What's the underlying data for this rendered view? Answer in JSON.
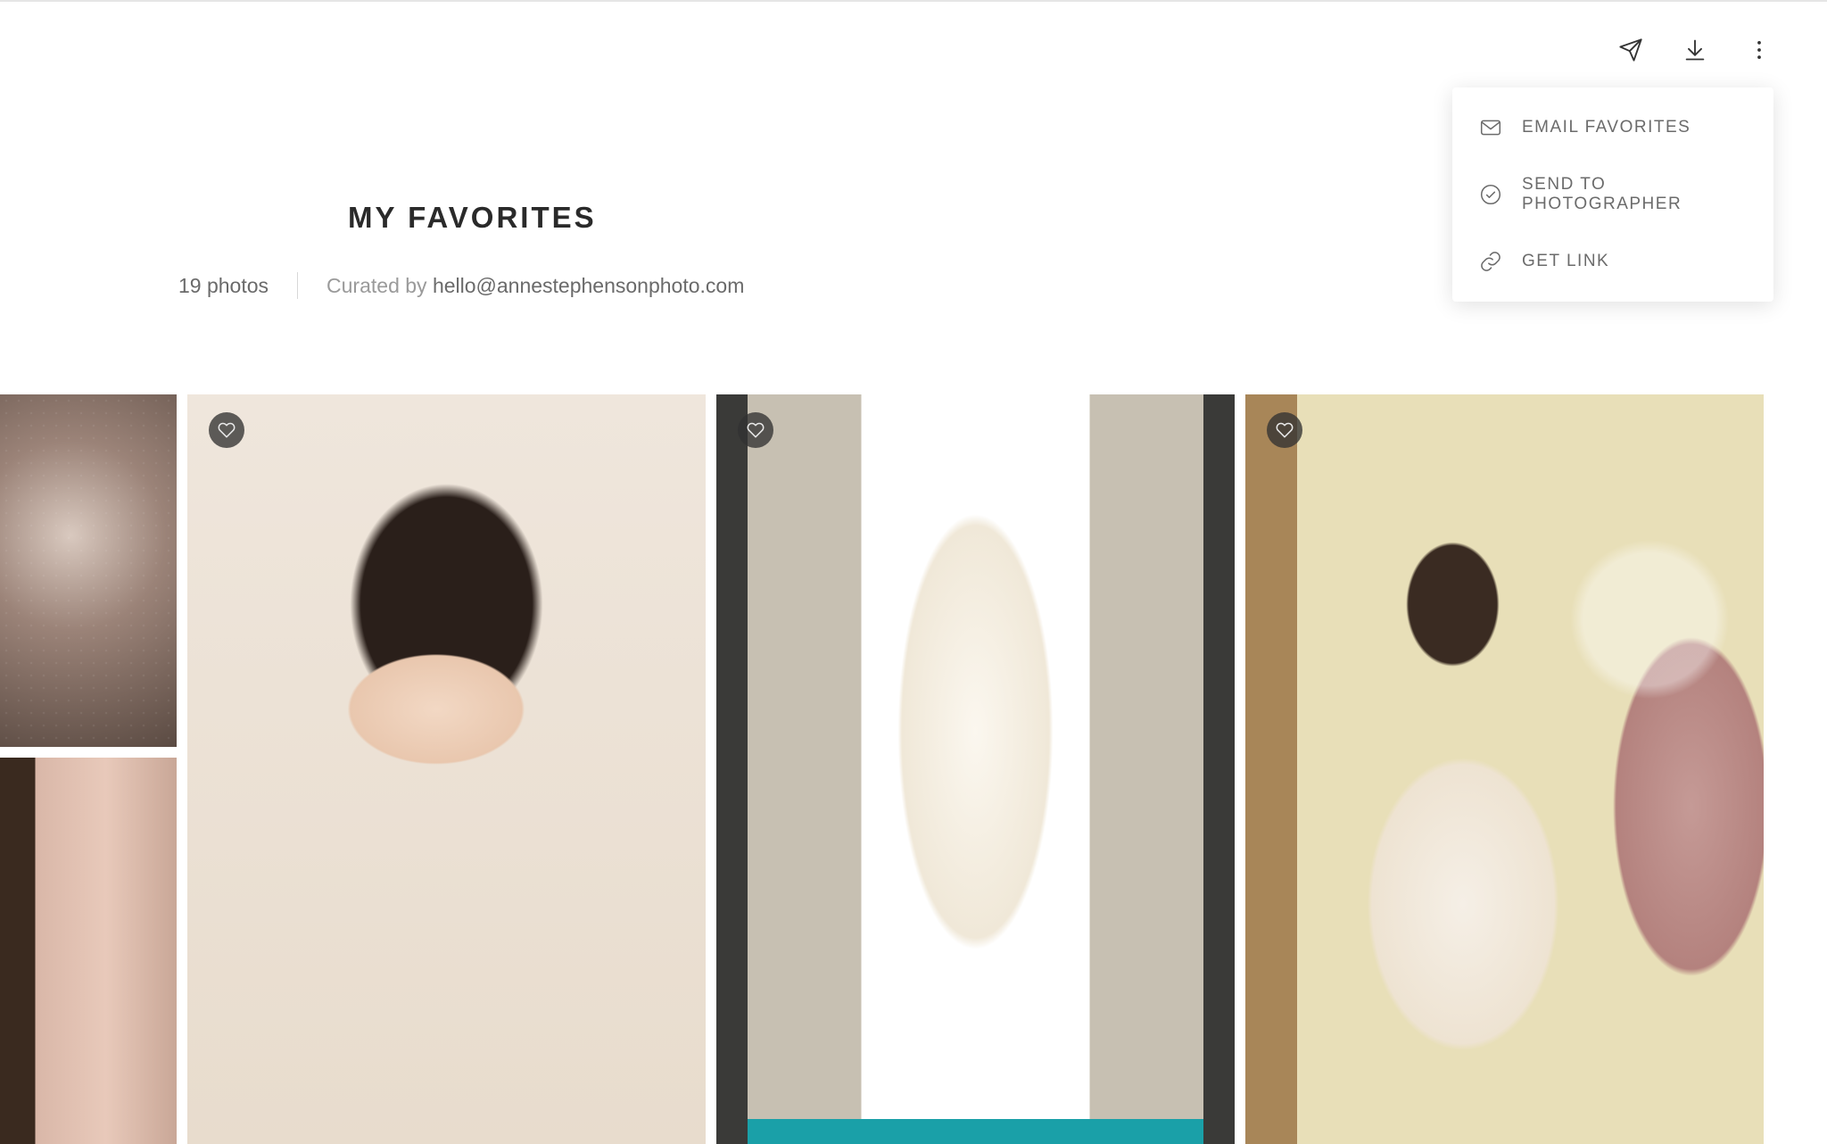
{
  "header": {
    "title": "MY FAVORITES",
    "photo_count": "19 photos",
    "curated_label": "Curated by ",
    "curated_by": "hello@annestephensonphoto.com"
  },
  "toolbar": {
    "share_icon": "paper-plane",
    "download_icon": "download",
    "more_icon": "more-vertical"
  },
  "dropdown": {
    "items": [
      {
        "icon": "envelope",
        "label": "EMAIL FAVORITES"
      },
      {
        "icon": "check-circle",
        "label": "SEND TO PHOTOGRAPHER"
      },
      {
        "icon": "link",
        "label": "GET LINK"
      }
    ]
  },
  "gallery": {
    "items": [
      {
        "alt": "sparkle-detail",
        "favorited": false
      },
      {
        "alt": "doorway-detail",
        "favorited": false
      },
      {
        "alt": "bride-makeup",
        "favorited": true
      },
      {
        "alt": "wedding-dress",
        "favorited": true
      },
      {
        "alt": "bride-getting-ready",
        "favorited": true
      }
    ]
  }
}
